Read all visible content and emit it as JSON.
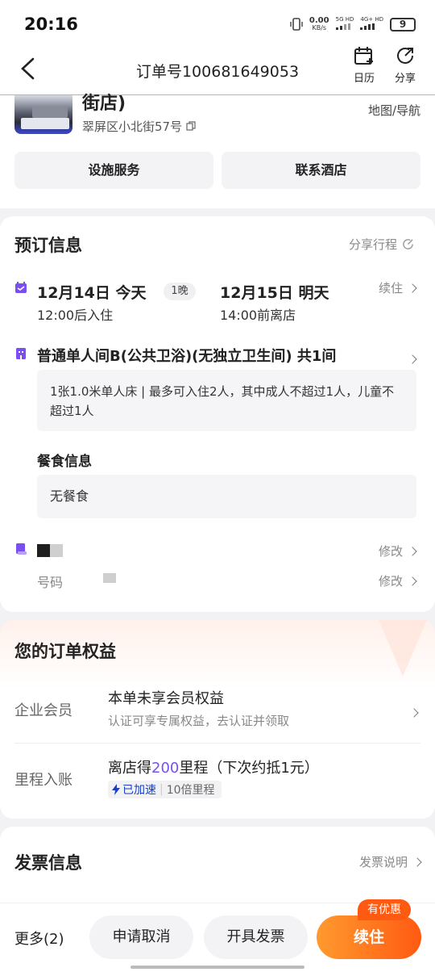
{
  "status_bar": {
    "time": "20:16",
    "net_speed_top": "0.00",
    "net_speed_unit": "KB/s",
    "sim1": "5G HD",
    "sim2": "4G+ HD",
    "battery": "9"
  },
  "header": {
    "title": "订单号100681649053",
    "calendar_label": "日历",
    "share_label": "分享"
  },
  "hotel": {
    "name_tail": "街店)",
    "address": "翠屏区小北街57号",
    "map_link": "地图/导航",
    "facility_button": "设施服务",
    "contact_button": "联系酒店"
  },
  "booking": {
    "title": "预订信息",
    "share_trip": "分享行程",
    "checkin_date": "12月14日 今天",
    "checkin_time": "12:00后入住",
    "nights": "1晚",
    "checkout_date": "12月15日 明天",
    "checkout_time": "14:00前离店",
    "extend": "续住",
    "room_name": "普通单人间B(公共卫浴)(无独立卫生间) 共1间",
    "room_desc": "1张1.0米单人床 | 最多可入住2人，其中成人不超过1人，儿童不超过1人",
    "meal_title": "餐食信息",
    "meal_value": "无餐食",
    "guest_edit": "修改",
    "phone_label": "号码",
    "phone_edit": "修改"
  },
  "benefits": {
    "title": "您的订单权益",
    "rows": [
      {
        "label": "企业会员",
        "main": "本单未享会员权益",
        "sub": "认证可享专属权益，去认证并领取"
      },
      {
        "label": "里程入账",
        "main_prefix": "离店得",
        "main_highlight": "200",
        "main_suffix": "里程（下次约抵1元）",
        "badge": "已加速",
        "badge_tail": "10倍里程"
      }
    ]
  },
  "invoice": {
    "title": "发票信息",
    "link": "发票说明"
  },
  "bottom_bar": {
    "more": "更多(2)",
    "cancel": "申请取消",
    "invoice": "开具发票",
    "extend": "续住",
    "promo_tag": "有优惠"
  },
  "colors": {
    "accent_purple": "#7a4ff0",
    "orange": "#ff6a1a"
  }
}
